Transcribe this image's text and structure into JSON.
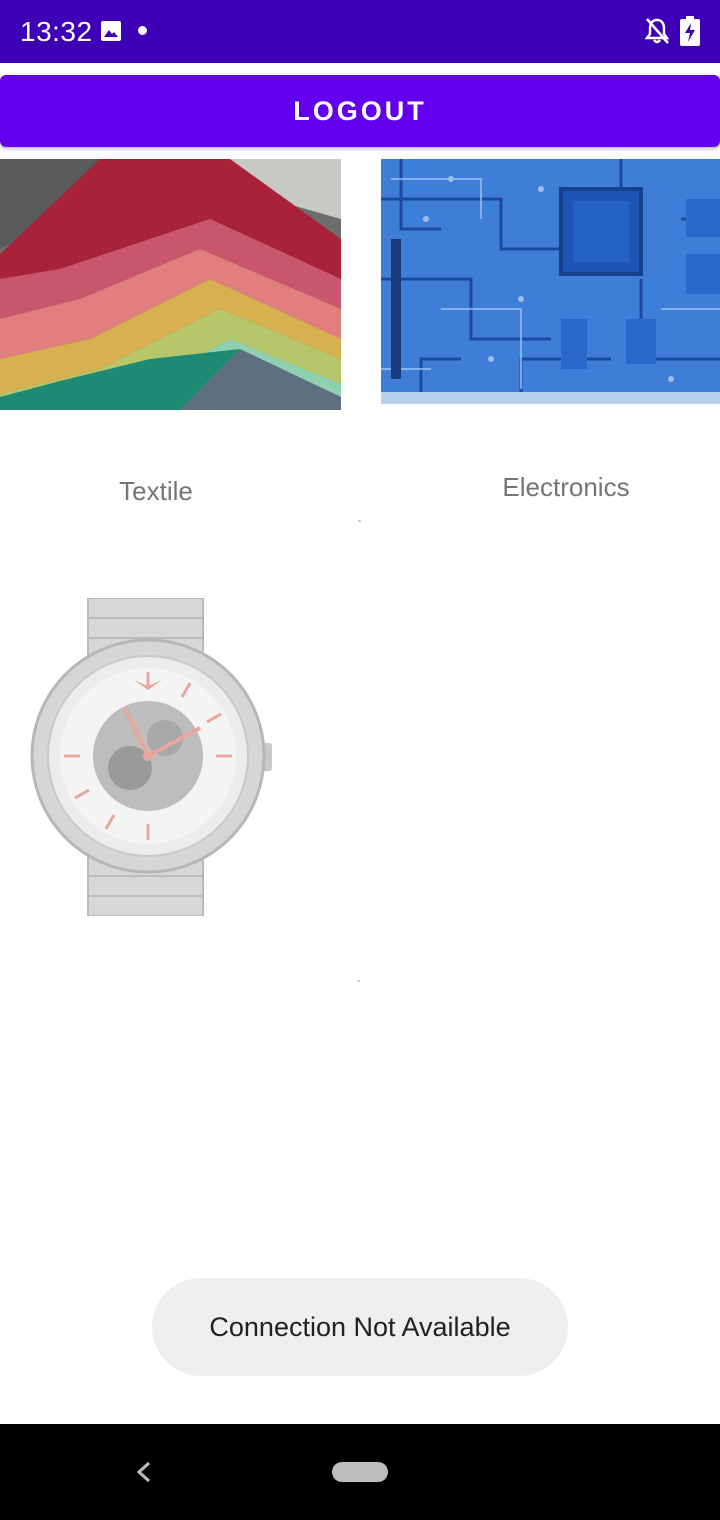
{
  "status_bar": {
    "time": "13:32",
    "icons": [
      "image-icon",
      "notification-dot-icon",
      "notifications-off-icon",
      "battery-charging-icon"
    ]
  },
  "logout_label": "LOGOUT",
  "categories": [
    {
      "label": "Textile",
      "image": "textile-fabric-image"
    },
    {
      "label": "Electronics",
      "image": "circuit-board-image"
    },
    {
      "label": "",
      "image": "wristwatch-image"
    }
  ],
  "toast": "Connection Not Available",
  "nav_bar": {
    "icons": [
      "back-icon",
      "home-pill-icon"
    ]
  },
  "colors": {
    "status_bar": "#3d00b5",
    "accent": "#6200ee",
    "label": "#757575",
    "toast_bg": "#efefef"
  }
}
